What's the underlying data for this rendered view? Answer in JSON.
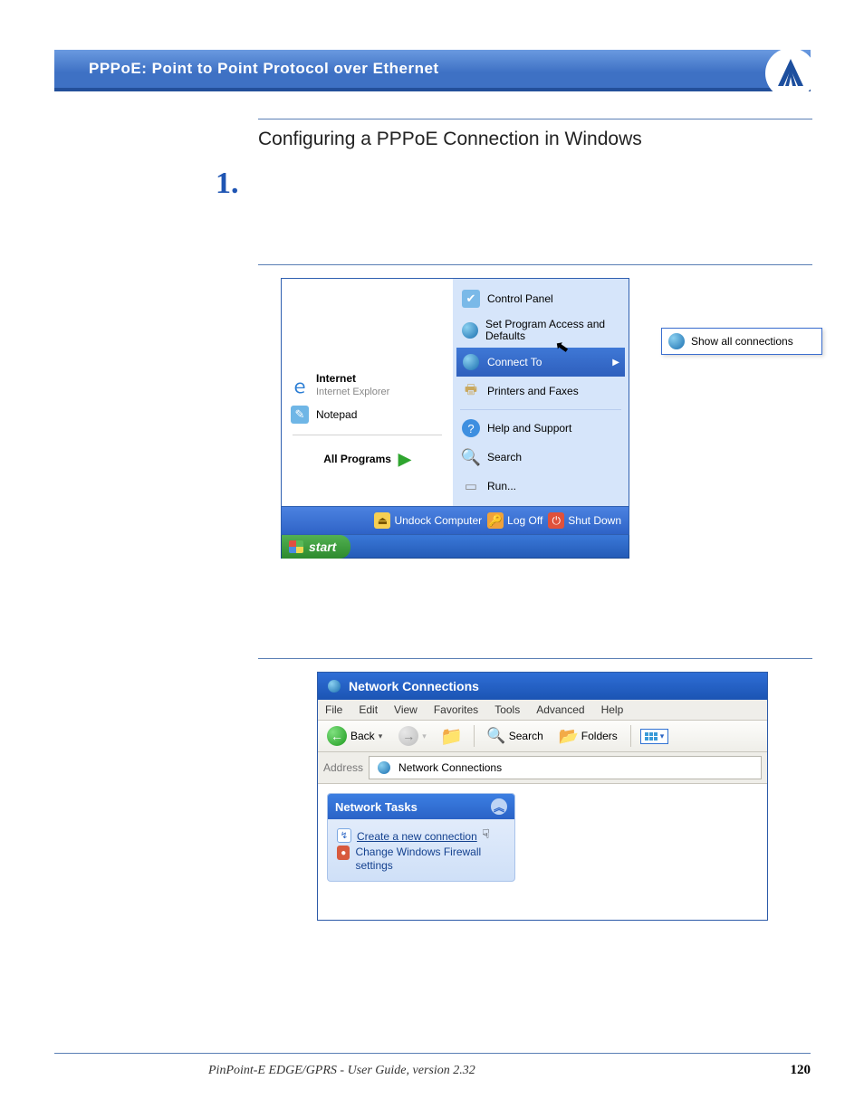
{
  "header": {
    "title": "PPPoE: Point to Point Protocol over Ethernet"
  },
  "section": {
    "heading": "Configuring a PPPoE Connection in Windows",
    "step": "1."
  },
  "startmenu": {
    "left": {
      "internet_title": "Internet",
      "internet_sub": "Internet Explorer",
      "notepad": "Notepad",
      "all_programs": "All Programs"
    },
    "right": {
      "control_panel": "Control Panel",
      "set_access": "Set Program Access and Defaults",
      "connect_to": "Connect To",
      "printers": "Printers and Faxes",
      "help": "Help and Support",
      "search": "Search",
      "run": "Run..."
    },
    "footer": {
      "undock": "Undock Computer",
      "logoff": "Log Off",
      "shutdown": "Shut Down"
    },
    "start": "start",
    "flyout": "Show all connections"
  },
  "netconn": {
    "title": "Network Connections",
    "menu": {
      "file": "File",
      "edit": "Edit",
      "view": "View",
      "favorites": "Favorites",
      "tools": "Tools",
      "advanced": "Advanced",
      "help": "Help"
    },
    "toolbar": {
      "back": "Back",
      "search": "Search",
      "folders": "Folders"
    },
    "address_label": "Address",
    "address_value": "Network Connections",
    "tasks": {
      "head": "Network Tasks",
      "create": "Create a new connection",
      "firewall": "Change Windows Firewall settings"
    }
  },
  "footer": {
    "text": "PinPoint-E EDGE/GPRS - User Guide, version 2.32",
    "page": "120"
  }
}
